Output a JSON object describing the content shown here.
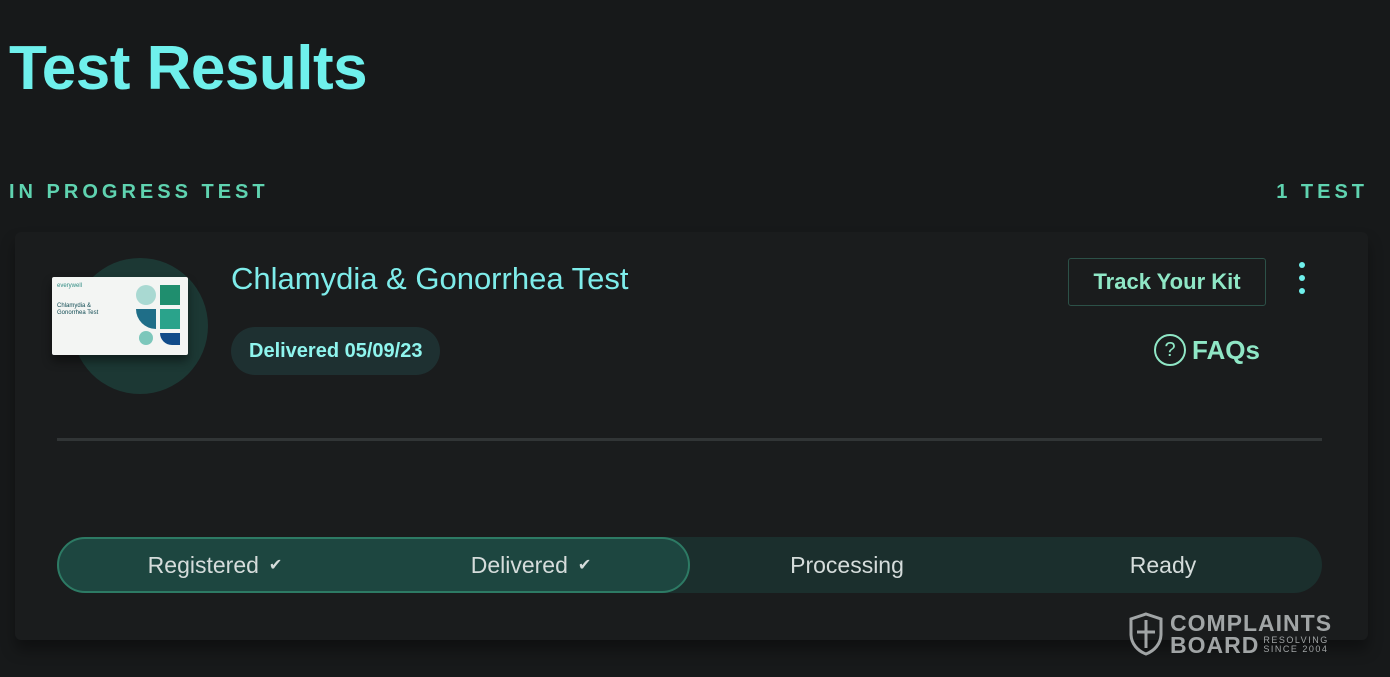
{
  "header": {
    "title": "Test Results"
  },
  "section": {
    "label": "IN PROGRESS TEST",
    "count": "1 TEST"
  },
  "test_card": {
    "kit_image": {
      "brand": "everywell",
      "name": "Chlamydia & Gonorrhea Test"
    },
    "name": "Chlamydia & Gonorrhea Test",
    "status_badge": "Delivered 05/09/23",
    "track_button": "Track Your Kit",
    "faq_link": "FAQs",
    "faq_icon": "question-circle-icon",
    "menu_icon": "kebab-menu-icon",
    "progress": {
      "completed_steps": 2,
      "steps": [
        {
          "label": "Registered",
          "done": true
        },
        {
          "label": "Delivered",
          "done": true
        },
        {
          "label": "Processing",
          "done": false
        },
        {
          "label": "Ready",
          "done": false
        }
      ]
    }
  },
  "watermark": {
    "line1": "COMPLAINTS",
    "line2": "BOARD",
    "tag1": "RESOLVING",
    "tag2": "SINCE 2004"
  },
  "colors": {
    "background": "#17191a",
    "accent": "#6ff0ec",
    "section_label": "#5fd3b0",
    "progress_fill": "#1d4640"
  }
}
